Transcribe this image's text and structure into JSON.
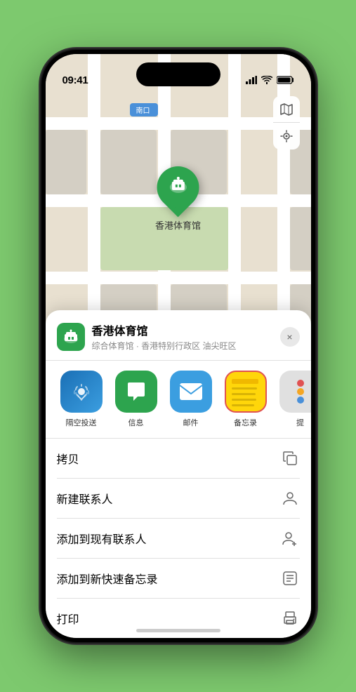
{
  "status_bar": {
    "time": "09:41",
    "location_icon": "▶",
    "signal": "▮▮▮▮",
    "wifi": "wifi",
    "battery": "battery"
  },
  "map": {
    "south_entrance_label": "南口",
    "venue_pin_label": "香港体育馆"
  },
  "map_controls": {
    "map_type_icon": "🗺",
    "location_icon": "➤"
  },
  "bottom_sheet": {
    "venue_name": "香港体育馆",
    "venue_subtitle": "综合体育馆 · 香港特别行政区 油尖旺区",
    "close_label": "×",
    "share_items": [
      {
        "id": "airdrop",
        "label": "隔空投送"
      },
      {
        "id": "messages",
        "label": "信息"
      },
      {
        "id": "mail",
        "label": "邮件"
      },
      {
        "id": "notes",
        "label": "备忘录"
      },
      {
        "id": "more",
        "label": "提"
      }
    ],
    "action_items": [
      {
        "id": "copy",
        "label": "拷贝",
        "icon": "copy"
      },
      {
        "id": "new-contact",
        "label": "新建联系人",
        "icon": "person"
      },
      {
        "id": "add-contact",
        "label": "添加到现有联系人",
        "icon": "person-plus"
      },
      {
        "id": "quick-note",
        "label": "添加到新快速备忘录",
        "icon": "note"
      },
      {
        "id": "print",
        "label": "打印",
        "icon": "print"
      }
    ]
  }
}
